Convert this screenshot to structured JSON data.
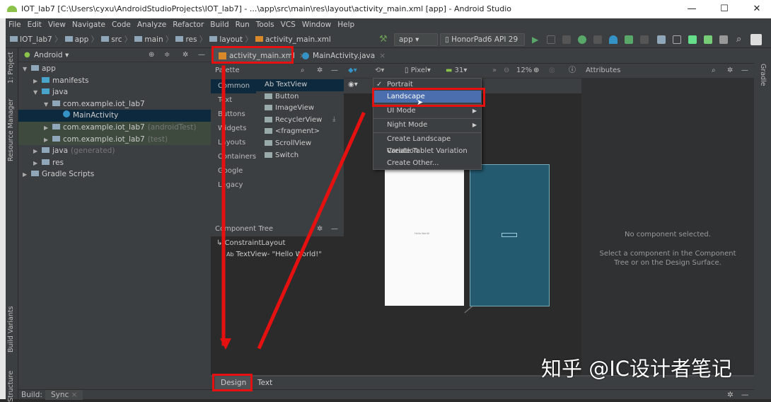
{
  "window": {
    "title": "IOT_lab7 [C:\\Users\\cyxu\\AndroidStudioProjects\\IOT_lab7] - ...\\app\\src\\main\\res\\layout\\activity_main.xml [app] - Android Studio",
    "minimize": "—",
    "maximize": "☐",
    "close": "✕"
  },
  "menu": [
    "File",
    "Edit",
    "View",
    "Navigate",
    "Code",
    "Analyze",
    "Refactor",
    "Build",
    "Run",
    "Tools",
    "VCS",
    "Window",
    "Help"
  ],
  "breadcrumb": [
    "IOT_lab7",
    "app",
    "src",
    "main",
    "res",
    "layout",
    "activity_main.xml"
  ],
  "toolbar": {
    "run_config": "app",
    "device": "HonorPad6 API 29"
  },
  "side_tools": {
    "project": "1: Project",
    "resource_manager": "Resource Manager",
    "build_variants": "Build Variants",
    "structure": "Structure",
    "gradle": "Gradle"
  },
  "project": {
    "view": "Android",
    "tree": [
      {
        "label": "app",
        "suffix": "",
        "level": 0,
        "arrow": "▼"
      },
      {
        "label": "manifests",
        "suffix": "",
        "level": 1,
        "arrow": "▶"
      },
      {
        "label": "java",
        "suffix": "",
        "level": 1,
        "arrow": "▼"
      },
      {
        "label": "com.example.iot_lab7",
        "suffix": "",
        "level": 2,
        "arrow": "▼"
      },
      {
        "label": "MainActivity",
        "suffix": "",
        "level": 3,
        "arrow": ""
      },
      {
        "label": "com.example.iot_lab7",
        "suffix": "(androidTest)",
        "level": 2,
        "arrow": "▶"
      },
      {
        "label": "com.example.iot_lab7",
        "suffix": "(test)",
        "level": 2,
        "arrow": "▶"
      },
      {
        "label": "java",
        "suffix": "(generated)",
        "level": 1,
        "arrow": "▶"
      },
      {
        "label": "res",
        "suffix": "",
        "level": 1,
        "arrow": "▶"
      },
      {
        "label": "Gradle Scripts",
        "suffix": "",
        "level": 0,
        "arrow": "▶"
      }
    ]
  },
  "editor_tabs": [
    {
      "label": "activity_main.xml",
      "close": "×"
    },
    {
      "label": "MainActivity.java",
      "close": "×"
    }
  ],
  "palette": {
    "title": "Palette",
    "categories": [
      "Common",
      "Text",
      "Buttons",
      "Widgets",
      "Layouts",
      "Containers",
      "Google",
      "Legacy"
    ],
    "items": [
      "Ab TextView",
      "Button",
      "ImageView",
      "RecyclerView",
      "<fragment>",
      "ScrollView",
      "Switch"
    ]
  },
  "design_toolbar": {
    "device": "Pixel",
    "api": "31",
    "zoom": "12%"
  },
  "orientation_menu": {
    "items": [
      "Portrait",
      "Landscape",
      "UI Mode",
      "Night Mode",
      "Create Landscape Variation",
      "Create Tablet Variation",
      "Create Other..."
    ],
    "checked": "✓",
    "selected": "Landscape"
  },
  "component_tree": {
    "title": "Component Tree",
    "items": [
      "ConstraintLayout",
      "TextView- \"Hello World!\""
    ],
    "ab": "Ab"
  },
  "attributes": {
    "title": "Attributes",
    "empty_title": "No component selected.",
    "empty_hint_1": "Select a component in the Component",
    "empty_hint_2": "Tree or on the Design Surface."
  },
  "preview": {
    "text": "Hello World!"
  },
  "mode_tabs": [
    "Design",
    "Text"
  ],
  "bottom": {
    "build": "Build:",
    "sync": "Sync",
    "sync_close": "×"
  },
  "watermark": "知乎 @IC设计者笔记",
  "colors": {
    "accent_red": "#e51010",
    "selection": "#4b6eaf",
    "blueprint": "#235a6f"
  }
}
